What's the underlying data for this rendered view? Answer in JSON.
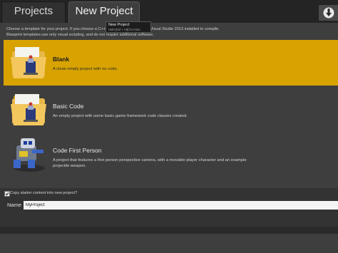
{
  "tabs": [
    {
      "label": "Projects",
      "active": false
    },
    {
      "label": "New Project",
      "active": true
    }
  ],
  "tooltip": {
    "title": "New Project",
    "hint": "Hold [Ctrl + Alt] for more"
  },
  "description": {
    "line1": "Choose a template for your project. If you choose a C++ template you must have Visual Studio 2013 installed to compile.",
    "line2": "Blueprint templates use only visual scripting, and do not require additional software."
  },
  "templates": [
    {
      "title": "Blank",
      "description": "A clean empty project with no code.",
      "selected": true,
      "icon": "folder-icon"
    },
    {
      "title": "Basic Code",
      "description": "An empty project with some basic game framework code classes created.",
      "selected": false,
      "icon": "folder-icon"
    },
    {
      "title": "Code First Person",
      "description": "A project that features a first person perspective camera, with a movable player character and an example projectile weapon.",
      "selected": false,
      "icon": "robot-icon"
    }
  ],
  "starter_content": {
    "label": "Copy starter content into new project?",
    "checked": true
  },
  "name_field": {
    "label": "Name",
    "value": "MyProject"
  },
  "colors": {
    "selected": "#d8a300",
    "background": "#3e3e3e",
    "topbar": "#242424"
  }
}
